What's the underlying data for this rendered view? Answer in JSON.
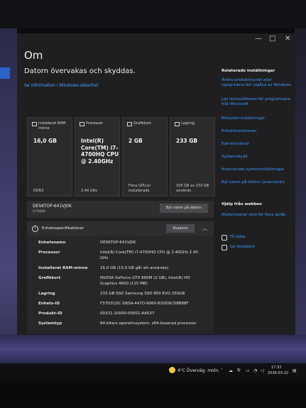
{
  "window": {
    "minimize": "—",
    "maximize": "□",
    "close": "✕"
  },
  "page": {
    "title": "Om",
    "subtitle": "Datorn övervakas och skyddas.",
    "security_link": "Se information i Windows-säkerhet"
  },
  "cards": [
    {
      "icon": "ram-icon",
      "label": "Installerat RAM-minne",
      "value": "16,0 GB",
      "foot": "DDR3"
    },
    {
      "icon": "processor-icon",
      "label": "Processor",
      "value": "Intel(R) Core(TM) i7-4700HQ CPU @ 2.40GHz",
      "foot": "2.40 GHz"
    },
    {
      "icon": "graphics-card-icon",
      "label": "Grafikkort",
      "value": "2 GB",
      "foot": "Flera GPU:er installerade"
    },
    {
      "icon": "storage-icon",
      "label": "Lagring",
      "value": "233 GB",
      "foot": "105 GB av 233 GB används"
    }
  ],
  "device": {
    "name": "DESKTOP-641VJ0K",
    "model": "G750JM",
    "rename_label": "Byt namn på datorn"
  },
  "specs": {
    "title": "Enhetsspecifikationer",
    "copy_label": "Kopiera",
    "collapse_icon": "chevron-up-icon",
    "rows": [
      {
        "label": "Enhetsnamn",
        "value": "DESKTOP-641VJ0K"
      },
      {
        "label": "Processor",
        "value": "Intel(R) Core(TM) i7-4700HQ CPU @ 2.40GHz 2.40 GHz"
      },
      {
        "label": "Installerat RAM-minne",
        "value": "16,0 GB (15,9 GB går att använda)"
      },
      {
        "label": "Grafikkort",
        "value": "NVIDIA GeForce GTX 860M (2 GB), Intel(R) HD Graphics 4600 (115 MB)"
      },
      {
        "label": "Lagring",
        "value": "233 GB SSD Samsung SSD 850 EVO 250GB"
      },
      {
        "label": "Enhets-ID",
        "value": "F37D31DC-D65A-447D-9060-820D9CD8888F"
      },
      {
        "label": "Produkt-ID",
        "value": "00331-10000-00001-AA537"
      },
      {
        "label": "Systemtyp",
        "value": "64-bitars operativsystem, x64-baserad processor"
      }
    ]
  },
  "related": {
    "heading": "Relaterade inställningar",
    "links": [
      "Ändra produktnyckel eller uppgradera din utgåva av Windows",
      "Läs licensvillkoren för programvara från Microsoft",
      "BitLocker-inställningar",
      "Enhetshanteraren",
      "Fjärrskrivbord",
      "Systemskydd",
      "Avancerade systeminställningar",
      "Byt namn på datorn (avancerat)"
    ]
  },
  "web_help": {
    "heading": "Hjälp från webben",
    "link": "Moderniserat stöd för flera språk",
    "get_help": "Få hjälp",
    "feedback": "Ge feedback"
  },
  "taskbar": {
    "weather": "4°C Överväg. moln.",
    "time": "17:32",
    "date": "2026-03-22"
  }
}
